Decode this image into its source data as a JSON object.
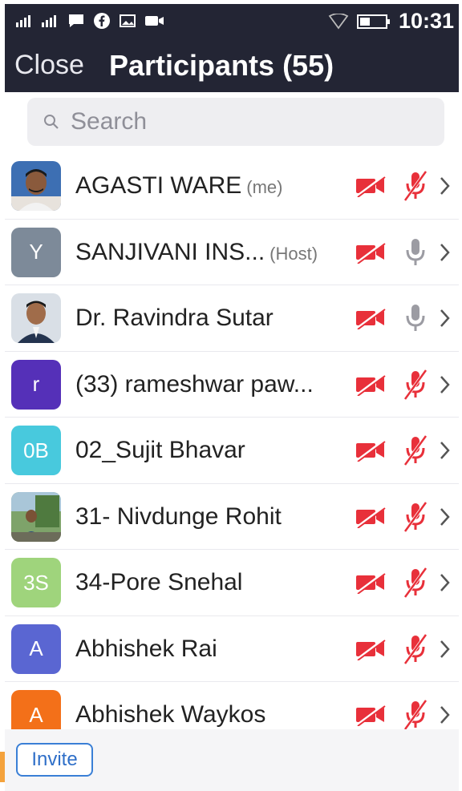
{
  "status_bar": {
    "time": "10:31"
  },
  "header": {
    "close_label": "Close",
    "title": "Participants (55)"
  },
  "search": {
    "placeholder": "Search"
  },
  "participants": [
    {
      "name": "AGASTI WARE",
      "tag": "(me)",
      "avatar": "photo",
      "video": "off",
      "mic": "muted"
    },
    {
      "name": "SANJIVANI INS...",
      "tag": "(Host)",
      "avatar_text": "Y",
      "avatar_color": "#7d8a99",
      "video": "off",
      "mic": "unmuted"
    },
    {
      "name": "Dr. Ravindra Sutar",
      "tag": "",
      "avatar": "photo",
      "video": "off",
      "mic": "unmuted"
    },
    {
      "name": "(33) rameshwar paw...",
      "tag": "",
      "avatar_text": "r",
      "avatar_color": "#5530b8",
      "video": "off",
      "mic": "muted"
    },
    {
      "name": "02_Sujit Bhavar",
      "tag": "",
      "avatar_text": "0B",
      "avatar_color": "#48c9dd",
      "video": "off",
      "mic": "muted"
    },
    {
      "name": "31- Nivdunge Rohit",
      "tag": "",
      "avatar": "photo",
      "video": "off",
      "mic": "muted"
    },
    {
      "name": "34-Pore Snehal",
      "tag": "",
      "avatar_text": "3S",
      "avatar_color": "#9fd47c",
      "video": "off",
      "mic": "muted"
    },
    {
      "name": "Abhishek Rai",
      "tag": "",
      "avatar_text": "A",
      "avatar_color": "#5a66d2",
      "video": "off",
      "mic": "muted"
    },
    {
      "name": "Abhishek Waykos",
      "tag": "",
      "avatar_text": "A",
      "avatar_color": "#f37019",
      "video": "off",
      "mic": "muted"
    }
  ],
  "footer": {
    "invite_label": "Invite"
  },
  "colors": {
    "header_bg": "#232534",
    "muted_red": "#e8303a",
    "link_blue": "#2f6fc8"
  }
}
